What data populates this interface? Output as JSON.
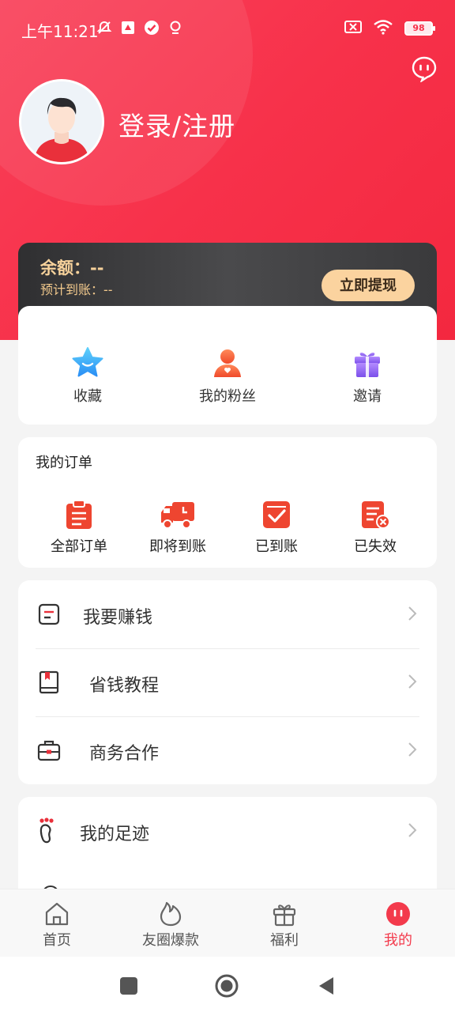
{
  "status_bar": {
    "time": "上午11:21",
    "battery": "98",
    "icons": [
      "notifications-off-icon",
      "app-notification-icon",
      "check-badge-icon",
      "location-icon",
      "sim-off-icon",
      "wifi-icon",
      "battery-icon"
    ]
  },
  "header": {
    "login_text": "登录/注册",
    "message_icon": "message-bubble-icon"
  },
  "balance": {
    "label": "余额：--",
    "expected": "预计到账：--",
    "withdraw_button": "立即提现"
  },
  "quick_actions": [
    {
      "label": "收藏",
      "icon": "star-icon"
    },
    {
      "label": "我的粉丝",
      "icon": "fans-icon"
    },
    {
      "label": "邀请",
      "icon": "gift-icon"
    }
  ],
  "orders": {
    "title": "我的订单",
    "items": [
      {
        "label": "全部订单",
        "icon": "clipboard-list-icon"
      },
      {
        "label": "即将到账",
        "icon": "delivery-truck-icon"
      },
      {
        "label": "已到账",
        "icon": "checked-box-icon"
      },
      {
        "label": "已失效",
        "icon": "expired-list-icon"
      }
    ]
  },
  "menu": [
    {
      "label": "我要赚钱",
      "icon": "earn-note-icon"
    },
    {
      "label": "省钱教程",
      "icon": "book-icon"
    },
    {
      "label": "商务合作",
      "icon": "briefcase-icon"
    }
  ],
  "menu2": [
    {
      "label": "我的足迹",
      "icon": "footprint-icon"
    }
  ],
  "tabbar": [
    {
      "label": "首页",
      "icon": "home-icon",
      "active": false
    },
    {
      "label": "友圈爆款",
      "icon": "flame-icon",
      "active": false
    },
    {
      "label": "福利",
      "icon": "gift-box-icon",
      "active": false
    },
    {
      "label": "我的",
      "icon": "profile-face-icon",
      "active": true
    }
  ],
  "colors": {
    "brand_red": "#f7314a",
    "gold": "#fbd39f",
    "active_tab": "#f33a4c"
  }
}
